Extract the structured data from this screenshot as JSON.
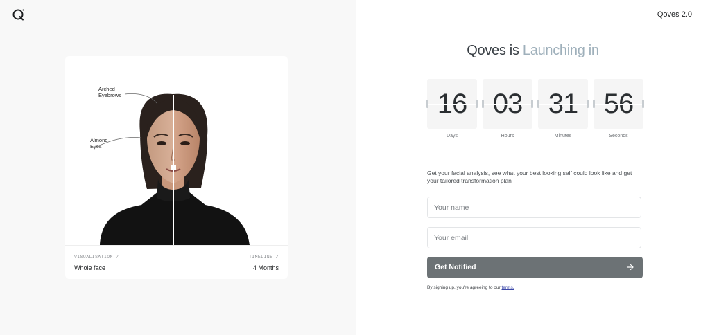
{
  "header": {
    "logo_icon": "q-logo-icon",
    "version": "Qoves 2.0"
  },
  "card": {
    "annotations": {
      "eyebrows": "Arched\nEyebrows",
      "eyes": "Almond\nEyes"
    },
    "visualisation_label": "VISUALISATION /",
    "visualisation_value": "Whole face",
    "timeline_label": "TIMELINE /",
    "timeline_value": "4 Months"
  },
  "launch": {
    "title_prefix": "Qoves is",
    "title_accent": "Launching in",
    "countdown": [
      {
        "value": "16",
        "label": "Days"
      },
      {
        "value": "03",
        "label": "Hours"
      },
      {
        "value": "31",
        "label": "Minutes"
      },
      {
        "value": "56",
        "label": "Seconds"
      }
    ],
    "description": "Get your facial analysis, see what your best looking self could look like and get your tailored transformation plan"
  },
  "form": {
    "name_placeholder": "Your name",
    "email_placeholder": "Your email",
    "submit_label": "Get Notified",
    "submit_icon": "arrow-right-icon",
    "legal_text": "By signing up, you're agreeing to our",
    "legal_link": "terms."
  },
  "colors": {
    "left_bg": "#f8f8f8",
    "accent_text": "#9fb0bb",
    "button_bg": "#6c7275",
    "link": "#3b47a8"
  }
}
